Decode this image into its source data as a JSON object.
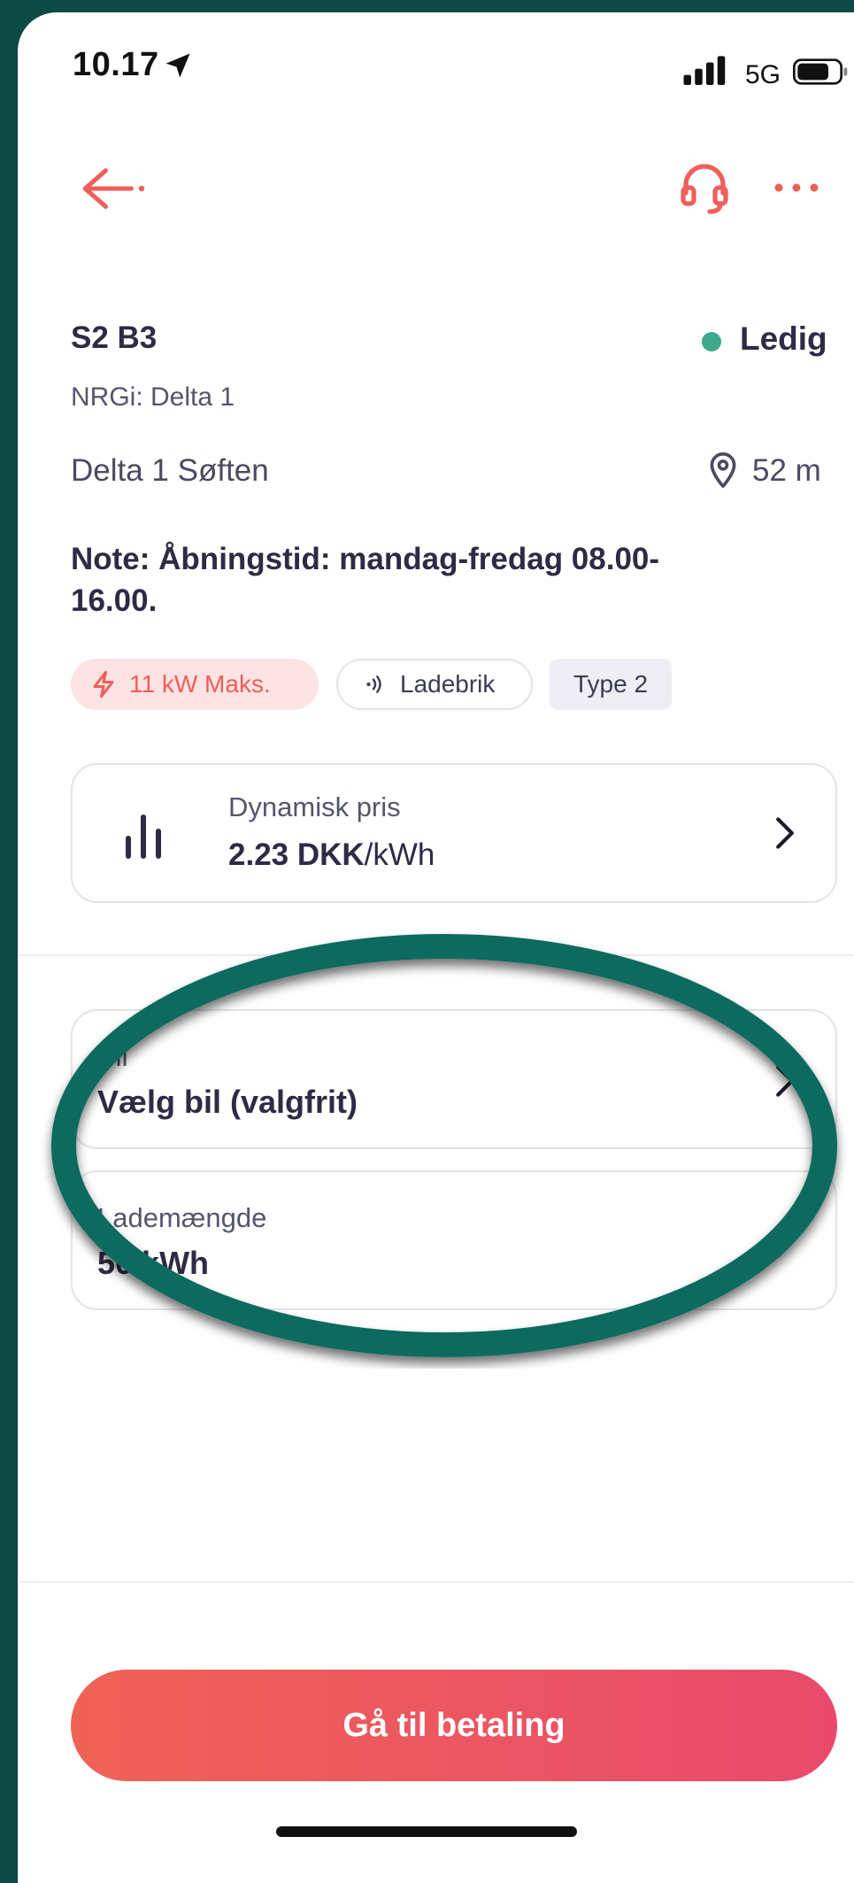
{
  "status_bar": {
    "time": "10.17",
    "network": "5G"
  },
  "station": {
    "id": "S2 B3",
    "status": "Ledig",
    "operator": "NRGi: Delta 1",
    "location": "Delta 1 Søften",
    "distance": "52 m",
    "note": "Note: Åbningstid: mandag-fredag 08.00-16.00."
  },
  "chips": {
    "power": "11 kW Maks.",
    "connector": "Ladebrik",
    "type": "Type 2"
  },
  "price": {
    "label": "Dynamisk pris",
    "amount": "2.23 DKK",
    "unit": "/kWh"
  },
  "car": {
    "label": "Bil",
    "value": "Vælg bil (valgfrit)"
  },
  "amount": {
    "label": "Lademængde",
    "value": "50 kWh"
  },
  "pay_button": "Gå til betaling",
  "colors": {
    "accent": "#ef5f5a",
    "status_available": "#3fa88d",
    "highlight": "#0e6b5f",
    "background_frame": "#0d4a45"
  }
}
